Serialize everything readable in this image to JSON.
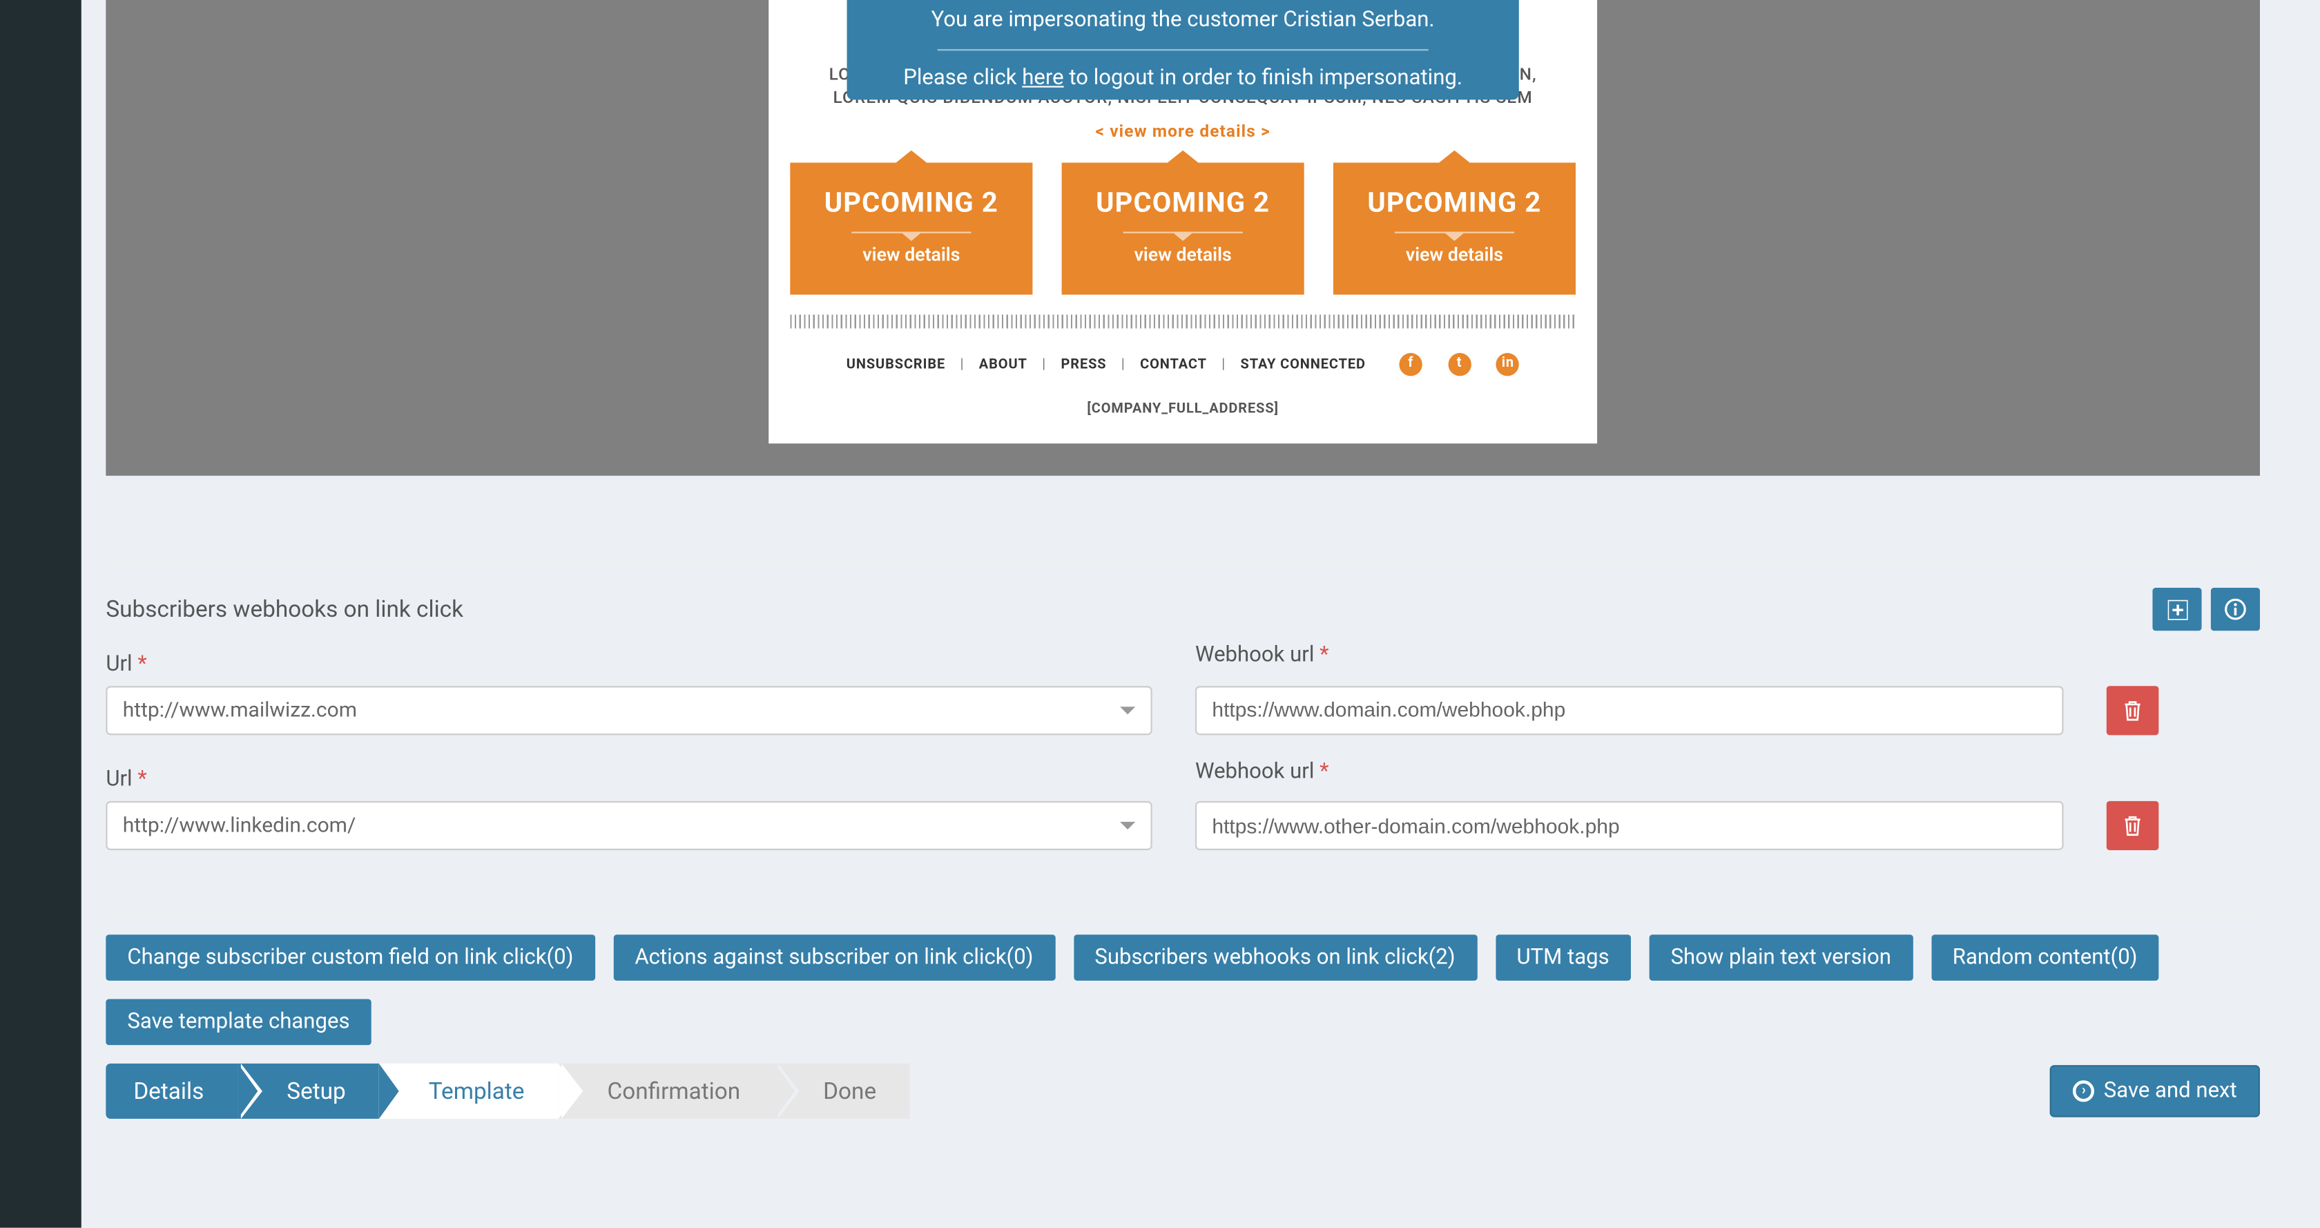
{
  "impersonate": {
    "line1": "You are impersonating the customer Cristian Serban.",
    "line2a": "Please click ",
    "here": "here",
    "line2b": " to logout in order to finish impersonating."
  },
  "preview": {
    "lorem": "LOREM IPSUM. PROIN GRAVIDA NIBH VEL AUCTOR ALIQUET. AENEAN SOLLICITUDIN, LOREM QUIS BIBENDUM AUCTOR, NISI ELIT CONSEQUAT IPSUM, NEC SAGITTIS SEM",
    "more": "< view more details >",
    "cards": [
      {
        "title": "UPCOMING 2",
        "vd": "view details"
      },
      {
        "title": "UPCOMING 2",
        "vd": "view details"
      },
      {
        "title": "UPCOMING 2",
        "vd": "view details"
      }
    ],
    "footer": {
      "unsubscribe": "UNSUBSCRIBE",
      "about": "ABOUT",
      "press": "PRESS",
      "contact": "CONTACT",
      "stay": "STAY CONNECTED"
    },
    "cfa": "[COMPANY_FULL_ADDRESS]"
  },
  "section": {
    "title": "Subscribers webhooks on link click",
    "url_label": "Url",
    "wh_label": "Webhook url"
  },
  "rows": [
    {
      "url": "http://www.mailwizz.com",
      "wh": "https://www.domain.com/webhook.php"
    },
    {
      "url": "http://www.linkedin.com/",
      "wh": "https://www.other-domain.com/webhook.php"
    }
  ],
  "buttons": {
    "b1": "Change subscriber custom field on link click(0)",
    "b2": "Actions against subscriber on link click(0)",
    "b3": "Subscribers webhooks on link click(2)",
    "b4": "UTM tags",
    "b5": "Show plain text version",
    "b6": "Random content(0)",
    "b7": "Save template changes"
  },
  "wizard": {
    "s1": "Details",
    "s2": "Setup",
    "s3": "Template",
    "s4": "Confirmation",
    "s5": "Done"
  },
  "save_next": "Save and next"
}
